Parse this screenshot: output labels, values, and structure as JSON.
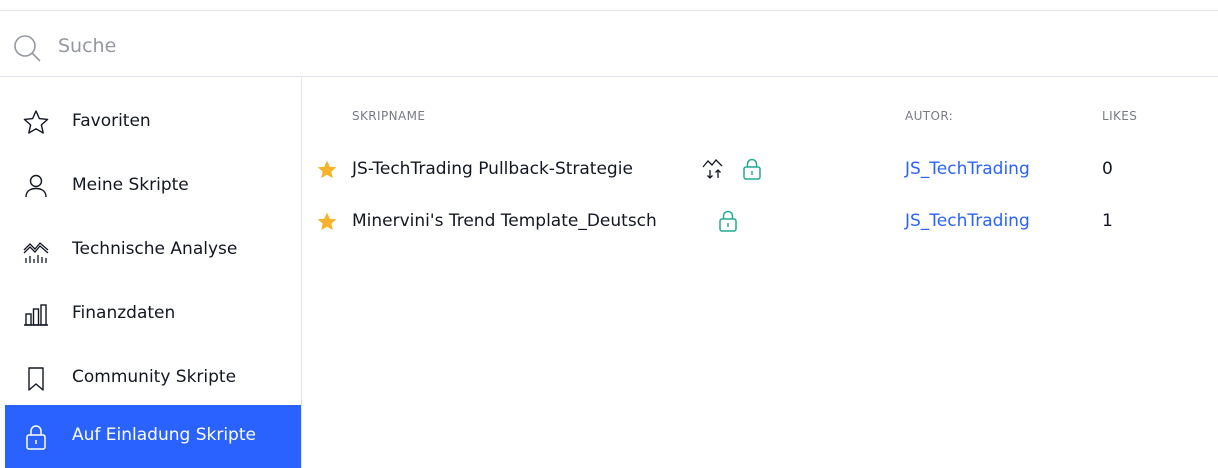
{
  "search": {
    "placeholder": "Suche",
    "value": ""
  },
  "sidebar": {
    "items": [
      {
        "label": "Favoriten",
        "icon": "star-outline-icon",
        "active": false
      },
      {
        "label": "Meine Skripte",
        "icon": "user-icon",
        "active": false
      },
      {
        "label": "Technische Analyse",
        "icon": "chart-analysis-icon",
        "active": false
      },
      {
        "label": "Finanzdaten",
        "icon": "bar-chart-icon",
        "active": false
      },
      {
        "label": "Community Skripte",
        "icon": "bookmark-icon",
        "active": false
      },
      {
        "label": "Auf Einladung Skripte",
        "icon": "lock-icon",
        "active": true
      }
    ]
  },
  "table": {
    "headers": {
      "name": "SKRIPNAME",
      "author": "AUTOR:",
      "likes": "LIKES"
    },
    "rows": [
      {
        "name": "JS-TechTrading Pullback-Strategie",
        "has_strategy_icon": true,
        "author": "JS_TechTrading",
        "likes": "0"
      },
      {
        "name": "Minervini's Trend Template_Deutsch",
        "has_strategy_icon": false,
        "author": "JS_TechTrading",
        "likes": "1"
      }
    ]
  },
  "colors": {
    "accent": "#2962ff",
    "star": "#f7b32b",
    "lock": "#22ab94",
    "border": "#e0e3eb",
    "muted": "#787b86"
  }
}
